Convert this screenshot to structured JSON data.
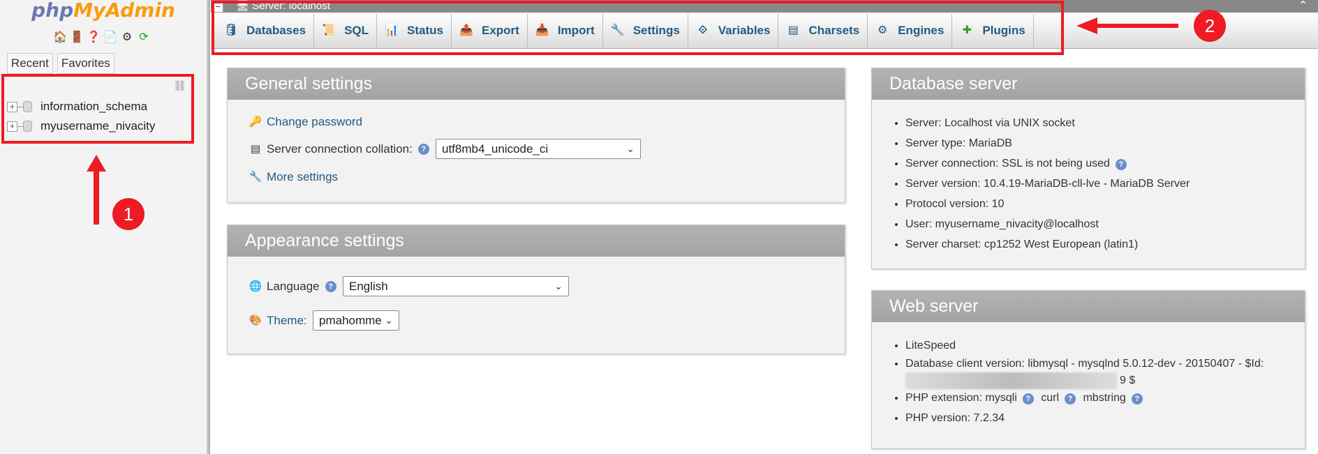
{
  "nav": {
    "logo_part1": "php",
    "logo_part2": "MyAdmin",
    "tabs": [
      "Recent",
      "Favorites"
    ],
    "databases": [
      "information_schema",
      "myusername_nivacity"
    ]
  },
  "annotations": {
    "badge1": "1",
    "badge2": "2"
  },
  "topbar": {
    "server_label": "Server: localhost"
  },
  "tabs": [
    "Databases",
    "SQL",
    "Status",
    "Export",
    "Import",
    "Settings",
    "Variables",
    "Charsets",
    "Engines",
    "Plugins"
  ],
  "general": {
    "title": "General settings",
    "change_password": "Change password",
    "collation_label": "Server connection collation:",
    "collation_value": "utf8mb4_unicode_ci",
    "more_settings": "More settings"
  },
  "appearance": {
    "title": "Appearance settings",
    "language_label": "Language",
    "language_value": "English",
    "theme_label": "Theme:",
    "theme_value": "pmahomme"
  },
  "db_server": {
    "title": "Database server",
    "items": [
      "Server: Localhost via UNIX socket",
      "Server type: MariaDB",
      "Server connection: SSL is not being used",
      "Server version: 10.4.19-MariaDB-cll-lve - MariaDB Server",
      "Protocol version: 10",
      "User: myusername_nivacity@localhost",
      "Server charset: cp1252 West European (latin1)"
    ]
  },
  "web_server": {
    "title": "Web server",
    "item1": "LiteSpeed",
    "item2": "Database client version: libmysql - mysqlnd 5.0.12-dev - 20150407 - $Id:",
    "item2_tail": "9 $",
    "item3_prefix": "PHP extension: mysqli",
    "item3_curl": "curl",
    "item3_mb": "mbstring",
    "item4": "PHP version: 7.2.34"
  },
  "colors": {
    "accent": "#235a81",
    "annotation": "#ee1b24",
    "panel_head": "#a9a9a9"
  }
}
